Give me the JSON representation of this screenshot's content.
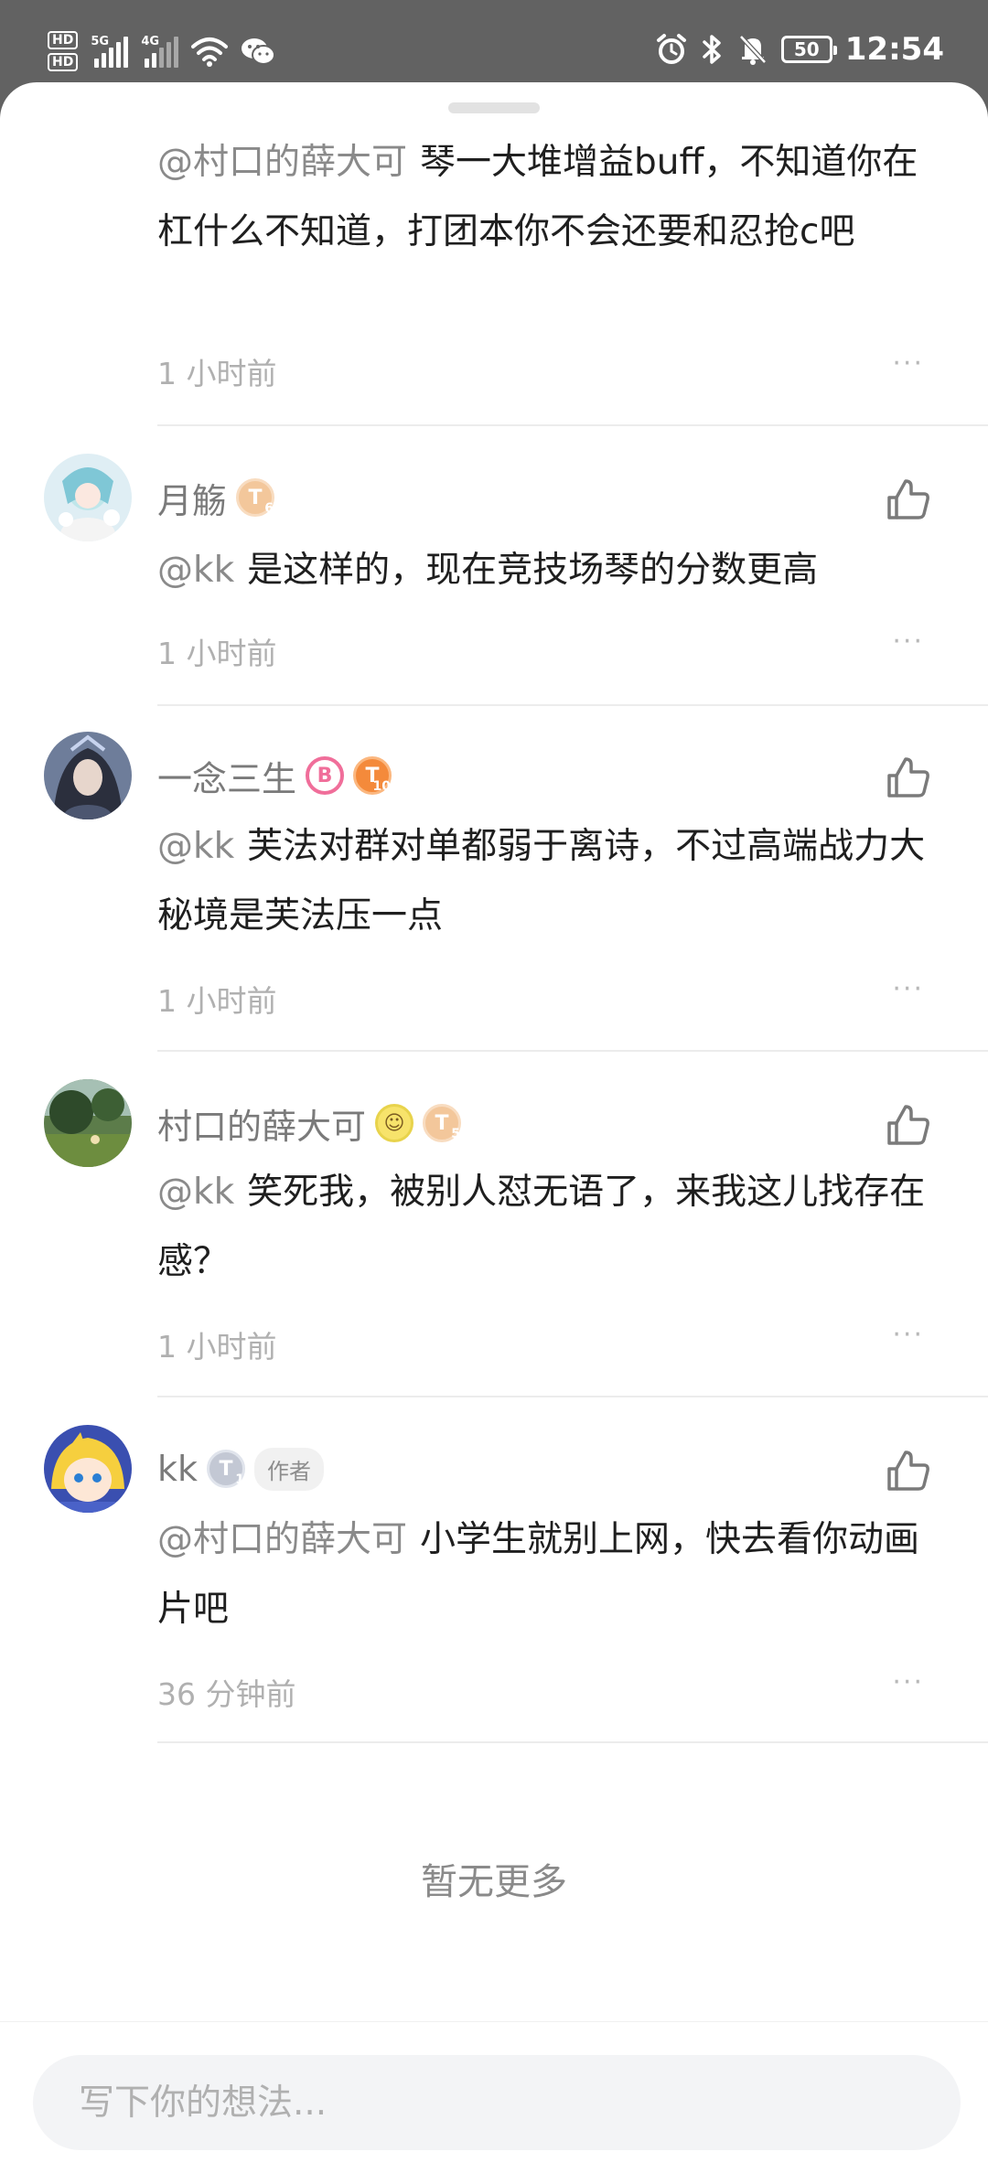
{
  "status_bar": {
    "hd_top": "HD",
    "hd_bottom": "HD",
    "net1": "5G",
    "net2": "4G",
    "battery": "50",
    "time": "12:54"
  },
  "comments": [
    {
      "mention": "@村口的薛大可",
      "body": "琴一大堆增益buff，不知道你在杠什么不知道，打团本你不会还要和忍抢c吧",
      "time": "1 小时前",
      "more": "···"
    },
    {
      "name": "月觞",
      "badges": [
        "T"
      ],
      "mention": "@kk",
      "body": "是这样的，现在竞技场琴的分数更高",
      "time": "1 小时前",
      "more": "···"
    },
    {
      "name": "一念三生",
      "badges": [
        "B",
        "T"
      ],
      "mention": "@kk",
      "body": "芙法对群对单都弱于离诗，不过高端战力大秘境是芙法压一点",
      "time": "1 小时前",
      "more": "···"
    },
    {
      "name": "村口的薛大可",
      "badges": [
        "T"
      ],
      "mention": "@kk",
      "body": "笑死我，被别人怼无语了，来我这儿找存在感？",
      "time": "1 小时前",
      "more": "···"
    },
    {
      "name": "kk",
      "badges": [
        "T"
      ],
      "author_tag": "作者",
      "mention": "@村口的薛大可",
      "body": "小学生就别上网，快去看你动画片吧",
      "time": "36 分钟前",
      "more": "···"
    }
  ],
  "no_more": "暂无更多",
  "input": {
    "placeholder": "写下你的想法..."
  },
  "icons": {
    "like": "thumbs-up-icon",
    "more": "more-dots-icon",
    "alarm": "alarm-icon",
    "bluetooth": "bluetooth-icon",
    "mute": "bell-off-icon",
    "wifi": "wifi-icon",
    "wechat": "wechat-icon"
  }
}
